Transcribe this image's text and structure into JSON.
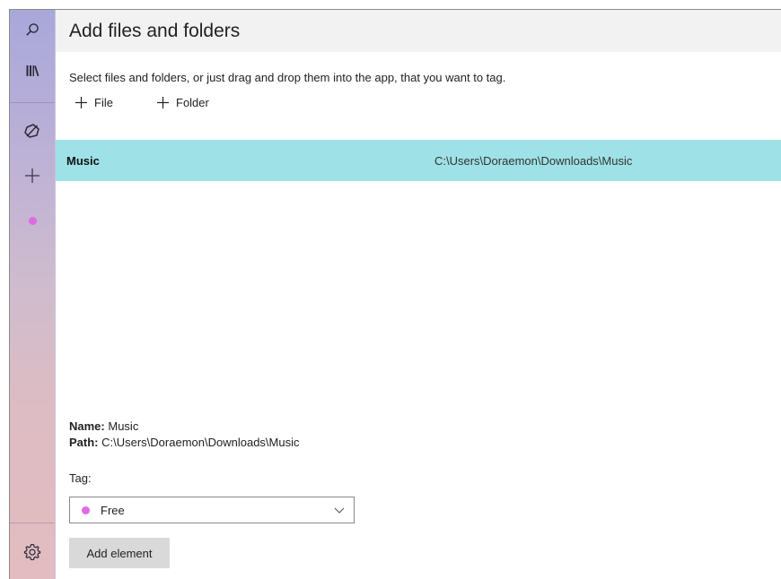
{
  "header": {
    "title": "Add files and folders"
  },
  "instructions": "Select files and folders, or just drag and drop them into the app, that you want to tag.",
  "actions": {
    "add_file_label": "File",
    "add_folder_label": "Folder"
  },
  "items": [
    {
      "name": "Music",
      "path": "C:\\Users\\Doraemon\\Downloads\\Music",
      "selected": true
    }
  ],
  "details": {
    "name_label": "Name:",
    "name_value": "Music",
    "path_label": "Path:",
    "path_value": "C:\\Users\\Doraemon\\Downloads\\Music"
  },
  "tag": {
    "label": "Tag:",
    "selected": "Free",
    "selected_color": "#e06be0"
  },
  "submit_label": "Add element",
  "sidebar": {
    "items": [
      {
        "icon": "search-icon"
      },
      {
        "icon": "library-icon"
      },
      {
        "icon": "tag-icon"
      },
      {
        "icon": "plus-icon"
      },
      {
        "icon": "tag-color-dot-icon",
        "color": "#e06be0"
      }
    ],
    "footer_icon": "gear-icon"
  },
  "colors": {
    "selected_row": "#9ee1e6",
    "header_bg": "#f2f2f2",
    "button_bg": "#d9d9d9"
  }
}
